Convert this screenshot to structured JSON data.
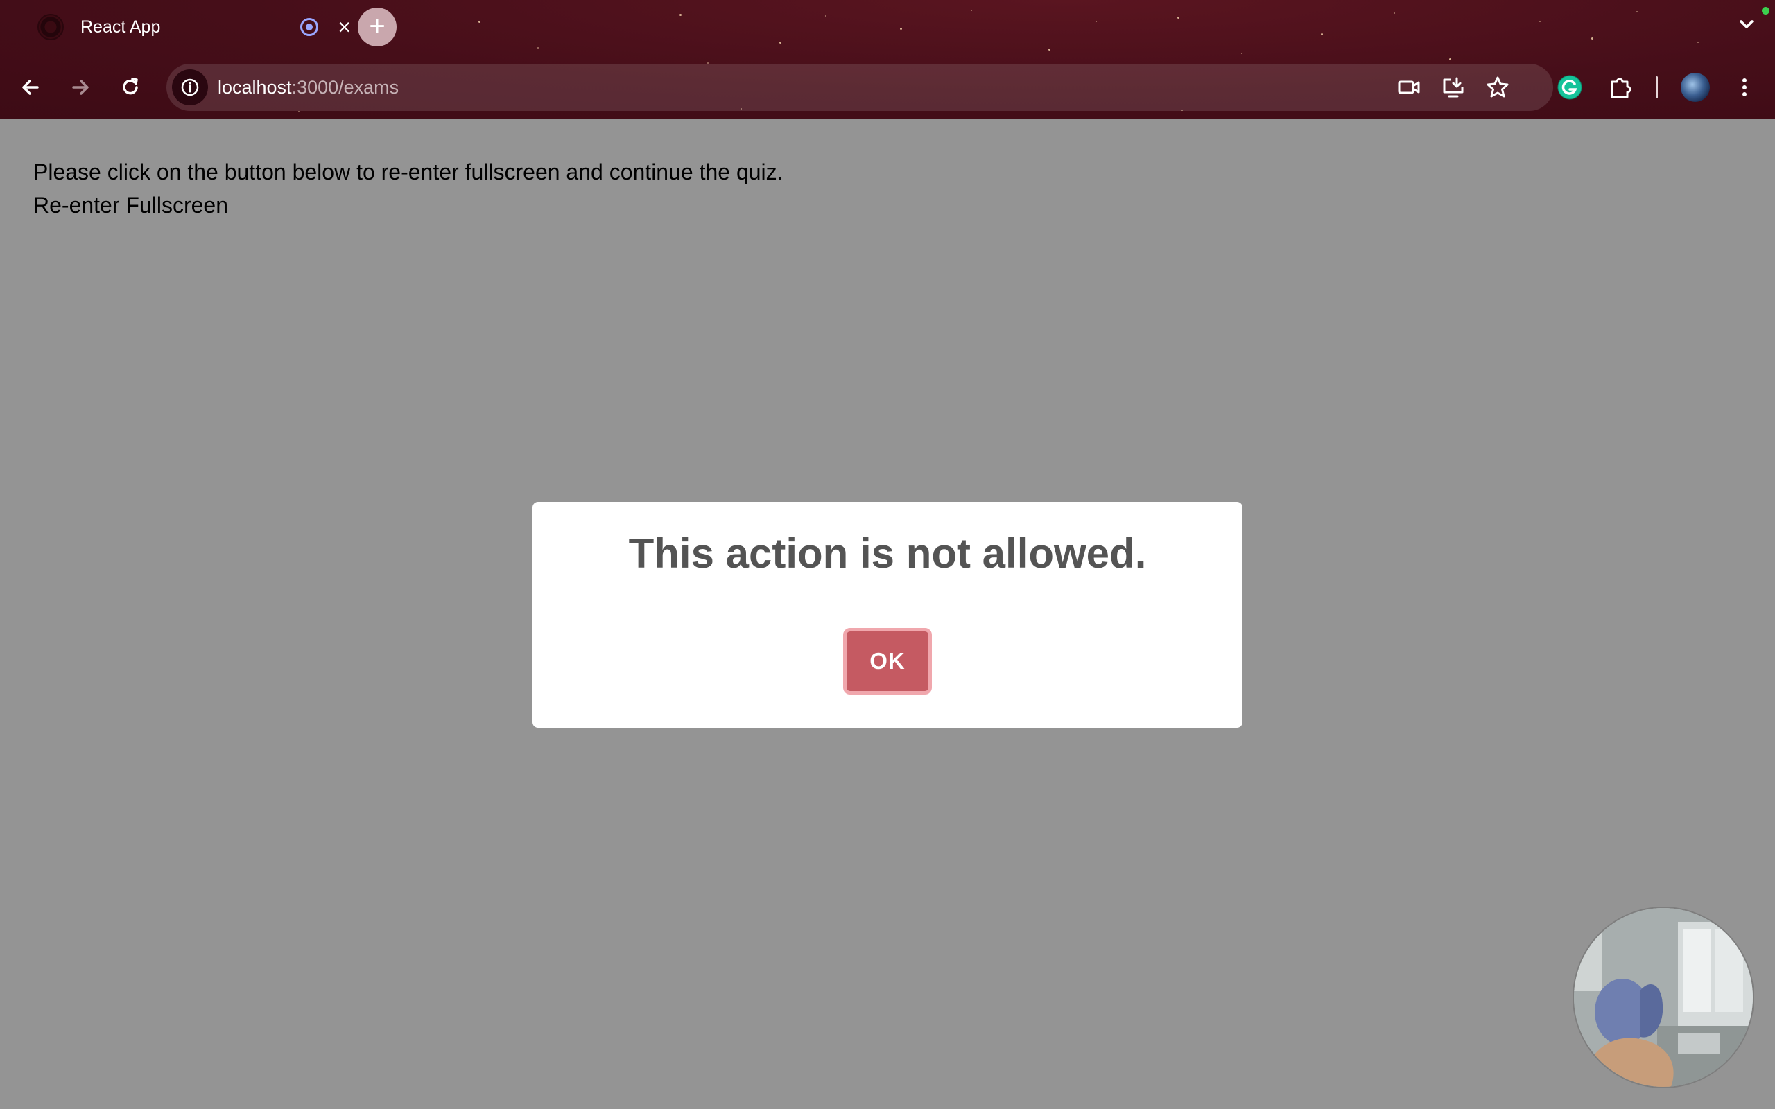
{
  "browser": {
    "tab_title": "React App",
    "tab_close_glyph": "×",
    "new_tab_glyph": "+",
    "url_host": "localhost",
    "url_rest": ":3000/exams",
    "accent_color": "#460e19",
    "icons": [
      "back-arrow-icon",
      "forward-arrow-icon",
      "reload-icon",
      "site-info-icon",
      "camera-icon",
      "install-app-icon",
      "bookmark-star-icon",
      "grammarly-icon",
      "extensions-puzzle-icon",
      "profile-avatar",
      "kebab-menu-icon",
      "tab-list-chevron-icon"
    ]
  },
  "page": {
    "instruction_text": "Please click on the button below to re-enter fullscreen and continue the quiz.",
    "reenter_button_label": "Re-enter Fullscreen"
  },
  "modal": {
    "title": "This action is not allowed.",
    "ok_label": "OK",
    "ok_color": "#c55a62"
  }
}
